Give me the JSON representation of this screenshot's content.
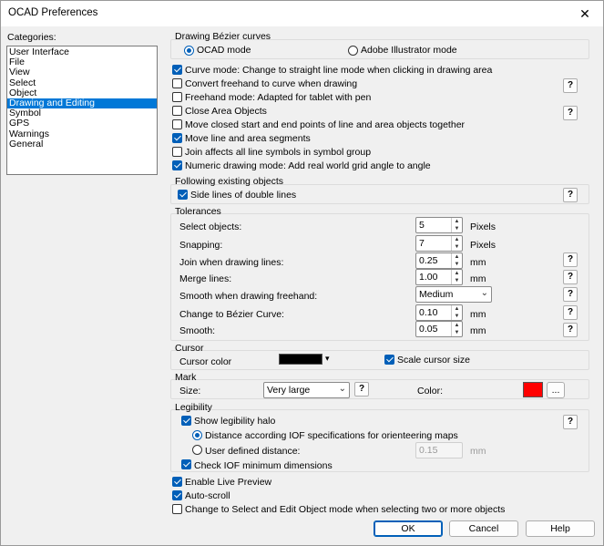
{
  "window": {
    "title": "OCAD Preferences",
    "close_glyph": "✕"
  },
  "categories": {
    "label": "Categories:",
    "items": [
      "User Interface",
      "File",
      "View",
      "Select",
      "Object",
      "Drawing and Editing",
      "Symbol",
      "GPS",
      "Warnings",
      "General"
    ],
    "selected": "Drawing and Editing"
  },
  "bezier": {
    "title": "Drawing Bézier curves",
    "ocad_mode": "OCAD mode",
    "ai_mode": "Adobe Illustrator mode",
    "selected": "ocad_mode"
  },
  "options": [
    {
      "label": "Curve mode: Change to straight line mode when clicking in drawing area",
      "checked": true
    },
    {
      "label": "Convert freehand to curve when drawing",
      "checked": false
    },
    {
      "label": "Freehand mode: Adapted for tablet with pen",
      "checked": false
    },
    {
      "label": "Close Area Objects",
      "checked": false
    },
    {
      "label": "Move closed start and end points of line and area objects together",
      "checked": false
    },
    {
      "label": "Move line and area segments",
      "checked": true
    },
    {
      "label": "Join affects all line symbols in symbol group",
      "checked": false
    },
    {
      "label": "Numeric drawing mode: Add real world grid angle to angle",
      "checked": true
    }
  ],
  "following": {
    "title": "Following existing objects",
    "side_lines": "Side lines of double lines",
    "side_lines_checked": true
  },
  "tolerances": {
    "title": "Tolerances",
    "select_objects": {
      "label": "Select objects:",
      "value": "5",
      "unit": "Pixels"
    },
    "snapping": {
      "label": "Snapping:",
      "value": "7",
      "unit": "Pixels"
    },
    "join": {
      "label": "Join when drawing lines:",
      "value": "0.25",
      "unit": "mm"
    },
    "merge": {
      "label": "Merge lines:",
      "value": "1.00",
      "unit": "mm"
    },
    "smooth_freehand": {
      "label": "Smooth when drawing freehand:",
      "value": "Medium"
    },
    "bezier": {
      "label": "Change to Bézier Curve:",
      "value": "0.10",
      "unit": "mm"
    },
    "smooth": {
      "label": "Smooth:",
      "value": "0.05",
      "unit": "mm"
    }
  },
  "cursor": {
    "title": "Cursor",
    "color_label": "Cursor color",
    "color": "#000000",
    "scale_label": "Scale cursor size",
    "scale_checked": true
  },
  "mark": {
    "title": "Mark",
    "size_label": "Size:",
    "size_value": "Very large",
    "color_label": "Color:",
    "color": "#ff0000",
    "ellipsis": "..."
  },
  "legibility": {
    "title": "Legibility",
    "show_halo": "Show legibility halo",
    "show_halo_checked": true,
    "iof": "Distance according IOF specifications for orienteering maps",
    "user_defined": "User defined distance:",
    "user_value": "0.15",
    "user_unit": "mm",
    "selected": "iof",
    "check_iof": "Check IOF minimum dimensions",
    "check_iof_checked": true
  },
  "bottom": [
    {
      "label": "Enable Live Preview",
      "checked": true
    },
    {
      "label": "Auto-scroll",
      "checked": true
    },
    {
      "label": "Change to Select and Edit Object mode when selecting two or more objects",
      "checked": false
    }
  ],
  "buttons": {
    "ok": "OK",
    "cancel": "Cancel",
    "help": "Help"
  },
  "help_glyph": "?",
  "icons": {
    "spin_up": "▲",
    "spin_down": "▼",
    "dropdown": "⌄",
    "color_dropdown": "▾"
  }
}
